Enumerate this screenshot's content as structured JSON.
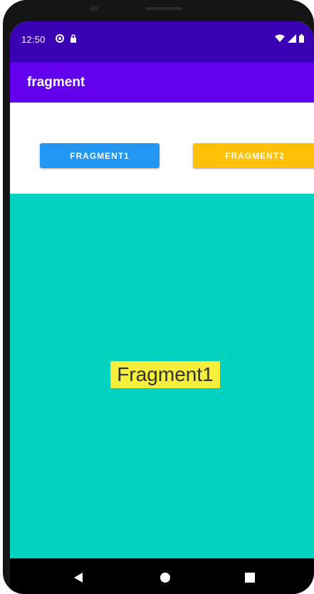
{
  "status_bar": {
    "time": "12:50",
    "left_icons": [
      "circle-status-icon",
      "lock-status-icon"
    ],
    "right_icons": [
      "wifi-icon",
      "signal-icon",
      "battery-icon"
    ]
  },
  "app_bar": {
    "title": "fragment",
    "color": "#6200ee"
  },
  "buttons": {
    "fragment1": {
      "label": "FRAGMENT1",
      "color": "#2196f3"
    },
    "fragment2": {
      "label": "FRAGMENT2",
      "color": "#ffc107"
    }
  },
  "fragment_container": {
    "background": "#00d2c0",
    "label": "Fragment1",
    "label_background": "#f5ee3a"
  },
  "nav_bar": {
    "icons": [
      "back-icon",
      "home-icon",
      "recents-icon"
    ]
  }
}
